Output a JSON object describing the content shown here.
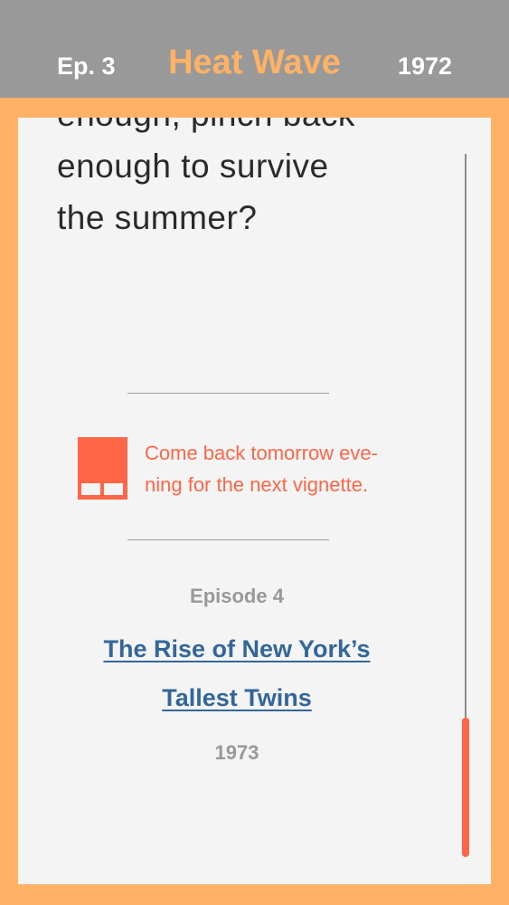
{
  "header": {
    "episode_label": "Ep. 3",
    "title": "Heat Wave",
    "year": "1972"
  },
  "story": {
    "lines": [
      "enough, pinch back",
      "enough to survive",
      "the summer?"
    ]
  },
  "notice": {
    "icon": "calendar-icon",
    "lines": [
      "Come back tomorrow eve-",
      "ning for the next vignette."
    ]
  },
  "next_episode": {
    "label": "Episode 4",
    "title_lines": [
      "The Rise of New York’s",
      "Tallest Twins"
    ],
    "year": "1973"
  },
  "colors": {
    "accent": "#ff6647",
    "frame": "#ffb266",
    "header_bg": "#999999",
    "link": "#336699",
    "card_bg": "#f4f4f4"
  }
}
